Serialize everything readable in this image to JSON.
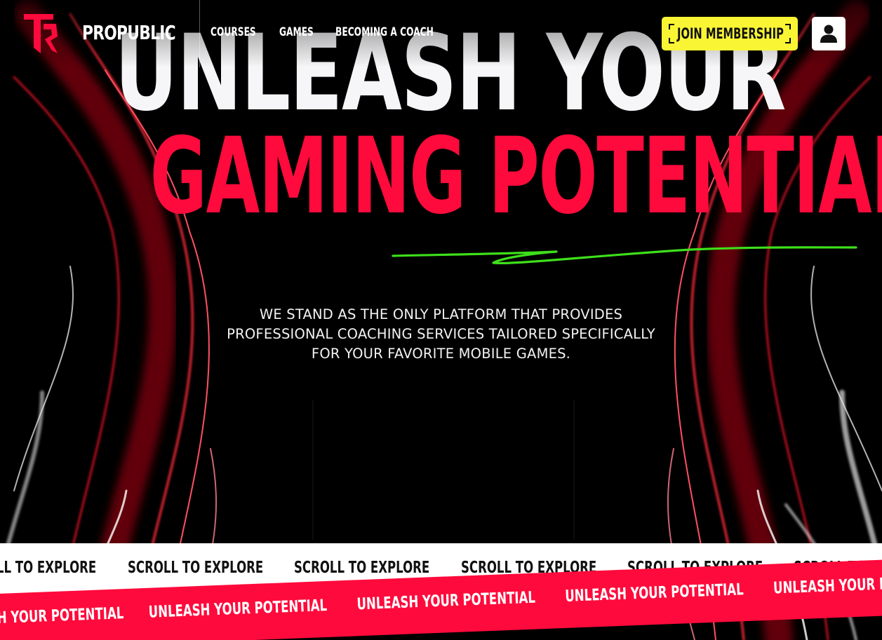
{
  "brand": {
    "name": "PROPUBLIC",
    "logo_icon": "pp-logo-icon"
  },
  "nav": {
    "items": [
      {
        "label": "COURSES"
      },
      {
        "label": "GAMES"
      },
      {
        "label": "BECOMING A COACH"
      }
    ]
  },
  "header_actions": {
    "join_label": "JOIN MEMBERSHIP",
    "user_icon": "user-icon"
  },
  "hero": {
    "line1": "UNLEASH YOUR",
    "line2": "GAMING POTENTIAL",
    "description": "WE STAND AS THE ONLY PLATFORM THAT PROVIDES PROFESSIONAL COACHING SERVICES TAILORED SPECIFICALLY FOR YOUR FAVORITE MOBILE GAMES."
  },
  "marquee": {
    "scroll_text": "SCROLL TO EXPLORE",
    "potential_text": "UNLEASH YOUR POTENTIAL"
  },
  "colors": {
    "accent_red": "#ff0a3c",
    "button_yellow": "#f9f534",
    "squiggle_green": "#3ee01a",
    "background": "#000000"
  }
}
